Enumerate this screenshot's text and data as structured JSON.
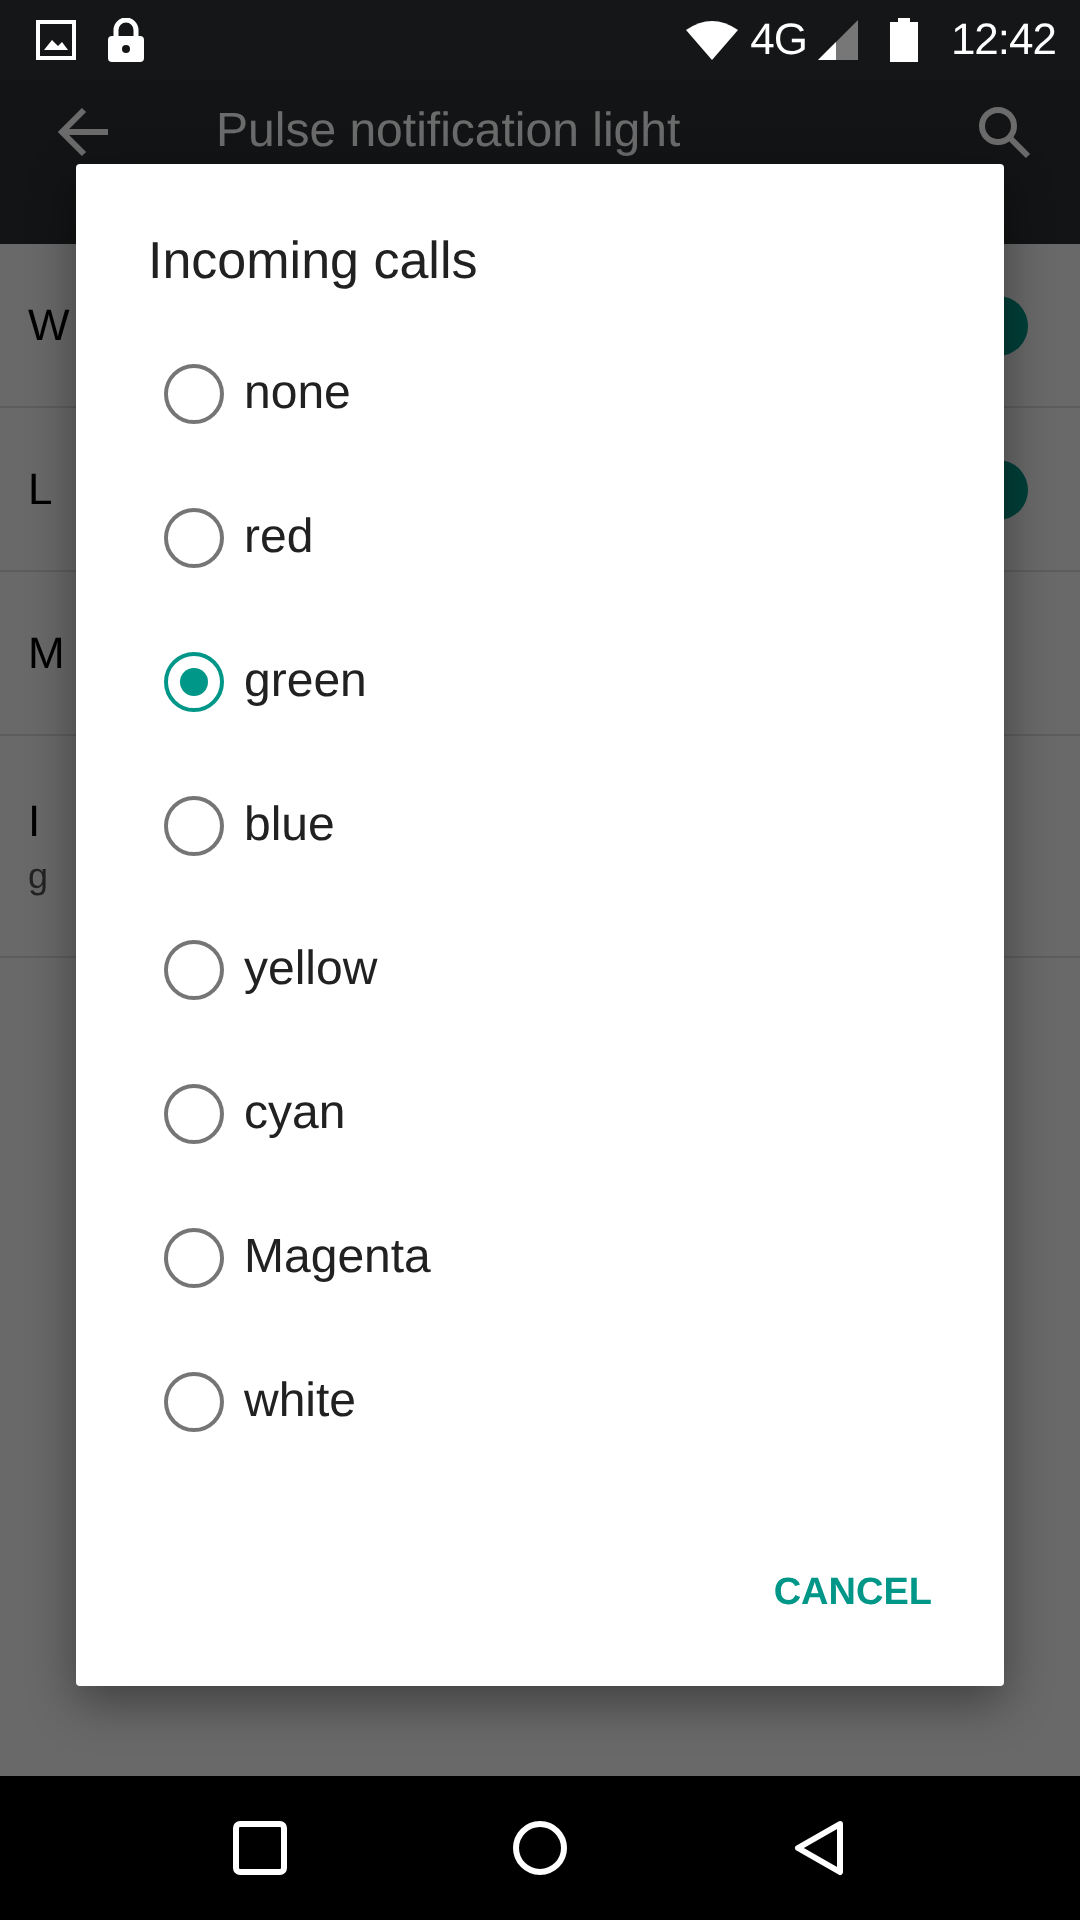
{
  "status_bar": {
    "network": "4G",
    "time": "12:42"
  },
  "app_bar": {
    "title": "Pulse notification light"
  },
  "settings": [
    {
      "kind": "switch",
      "title": "W",
      "on": true
    },
    {
      "kind": "switch",
      "title": "L",
      "on": true
    },
    {
      "kind": "plain",
      "title": "M"
    },
    {
      "kind": "plain",
      "title": "I",
      "summary": "g"
    }
  ],
  "dialog": {
    "title": "Incoming calls",
    "options": [
      {
        "label": "none",
        "selected": false
      },
      {
        "label": "red",
        "selected": false
      },
      {
        "label": "green",
        "selected": true
      },
      {
        "label": "blue",
        "selected": false
      },
      {
        "label": "yellow",
        "selected": false
      },
      {
        "label": "cyan",
        "selected": false
      },
      {
        "label": "Magenta",
        "selected": false
      },
      {
        "label": "white",
        "selected": false
      }
    ],
    "buttons": [
      "CANCEL"
    ]
  }
}
